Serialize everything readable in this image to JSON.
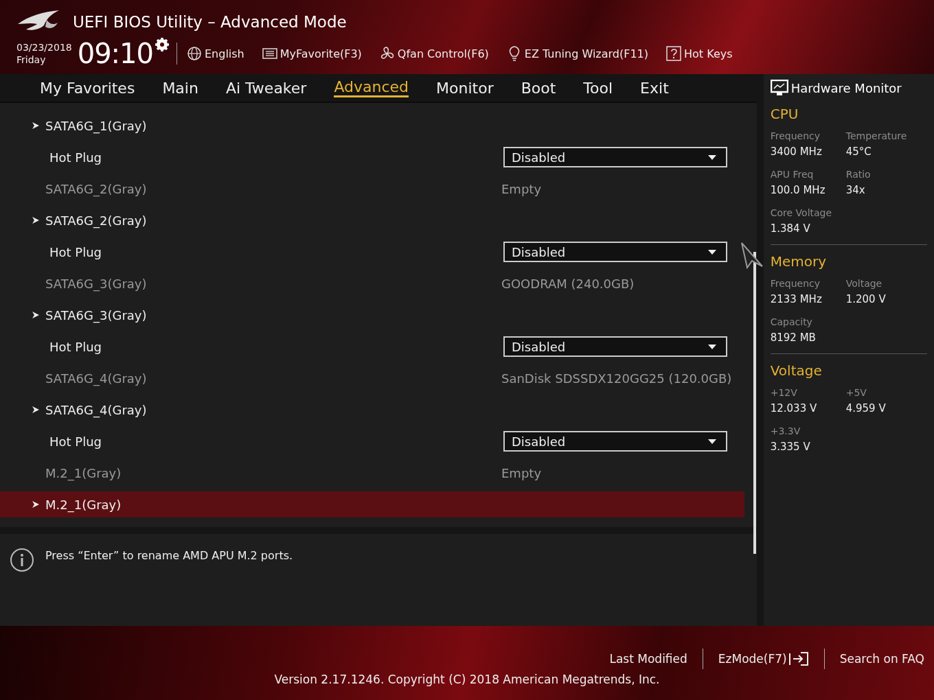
{
  "header": {
    "title": "UEFI BIOS Utility – Advanced Mode",
    "date": "03/23/2018",
    "day": "Friday",
    "time": "09:10",
    "tools": [
      {
        "kind": "globe",
        "label": "English"
      },
      {
        "kind": "favorite",
        "label": "MyFavorite(F3)"
      },
      {
        "kind": "fan",
        "label": "Qfan Control(F6)"
      },
      {
        "kind": "bulb",
        "label": "EZ Tuning Wizard(F11)"
      },
      {
        "kind": "help",
        "label": "Hot Keys"
      }
    ]
  },
  "tabs": [
    {
      "label": "My Favorites",
      "selected": false
    },
    {
      "label": "Main",
      "selected": false
    },
    {
      "label": "Ai Tweaker",
      "selected": false
    },
    {
      "label": "Advanced",
      "selected": true
    },
    {
      "label": "Monitor",
      "selected": false
    },
    {
      "label": "Boot",
      "selected": false
    },
    {
      "label": "Tool",
      "selected": false
    },
    {
      "label": "Exit",
      "selected": false
    }
  ],
  "rows": [
    {
      "kind": "submenu",
      "label": "SATA6G_1(Gray)",
      "selected": false
    },
    {
      "kind": "option",
      "label": "Hot Plug",
      "value": "Disabled",
      "selected": false
    },
    {
      "kind": "info",
      "label": "SATA6G_2(Gray)",
      "value": "Empty",
      "selected": false
    },
    {
      "kind": "submenu",
      "label": "SATA6G_2(Gray)",
      "selected": false
    },
    {
      "kind": "option",
      "label": "Hot Plug",
      "value": "Disabled",
      "selected": false
    },
    {
      "kind": "info",
      "label": "SATA6G_3(Gray)",
      "value": "GOODRAM (240.0GB)",
      "selected": false
    },
    {
      "kind": "submenu",
      "label": "SATA6G_3(Gray)",
      "selected": false
    },
    {
      "kind": "option",
      "label": "Hot Plug",
      "value": "Disabled",
      "selected": false
    },
    {
      "kind": "info",
      "label": "SATA6G_4(Gray)",
      "value": "SanDisk SDSSDX120GG25 (120.0GB)",
      "selected": false
    },
    {
      "kind": "submenu",
      "label": "SATA6G_4(Gray)",
      "selected": false
    },
    {
      "kind": "option",
      "label": "Hot Plug",
      "value": "Disabled",
      "selected": false
    },
    {
      "kind": "info",
      "label": "M.2_1(Gray)",
      "value": "Empty",
      "selected": false
    },
    {
      "kind": "submenu",
      "label": "M.2_1(Gray)",
      "selected": true
    }
  ],
  "help": {
    "text": "Press “Enter” to rename AMD APU M.2 ports."
  },
  "monitor": {
    "title": "Hardware Monitor",
    "sections": [
      {
        "title": "CPU",
        "items": [
          {
            "label": "Frequency",
            "value": "3400 MHz"
          },
          {
            "label": "Temperature",
            "value": "45°C"
          },
          {
            "label": "APU Freq",
            "value": "100.0 MHz"
          },
          {
            "label": "Ratio",
            "value": "34x"
          },
          {
            "label": "Core Voltage",
            "value": "1.384 V"
          }
        ]
      },
      {
        "title": "Memory",
        "items": [
          {
            "label": "Frequency",
            "value": "2133 MHz"
          },
          {
            "label": "Voltage",
            "value": "1.200 V"
          },
          {
            "label": "Capacity",
            "value": "8192 MB"
          }
        ]
      },
      {
        "title": "Voltage",
        "items": [
          {
            "label": "+12V",
            "value": "12.033 V"
          },
          {
            "label": "+5V",
            "value": "4.959 V"
          },
          {
            "label": "+3.3V",
            "value": "3.335 V"
          }
        ]
      }
    ]
  },
  "footer": {
    "links": [
      {
        "kind": "text",
        "label": "Last Modified"
      },
      {
        "kind": "exit",
        "label": "EzMode(F7)"
      },
      {
        "kind": "text",
        "label": "Search on FAQ"
      }
    ],
    "version": "Version 2.17.1246. Copyright (C) 2018 American Megatrends, Inc."
  }
}
